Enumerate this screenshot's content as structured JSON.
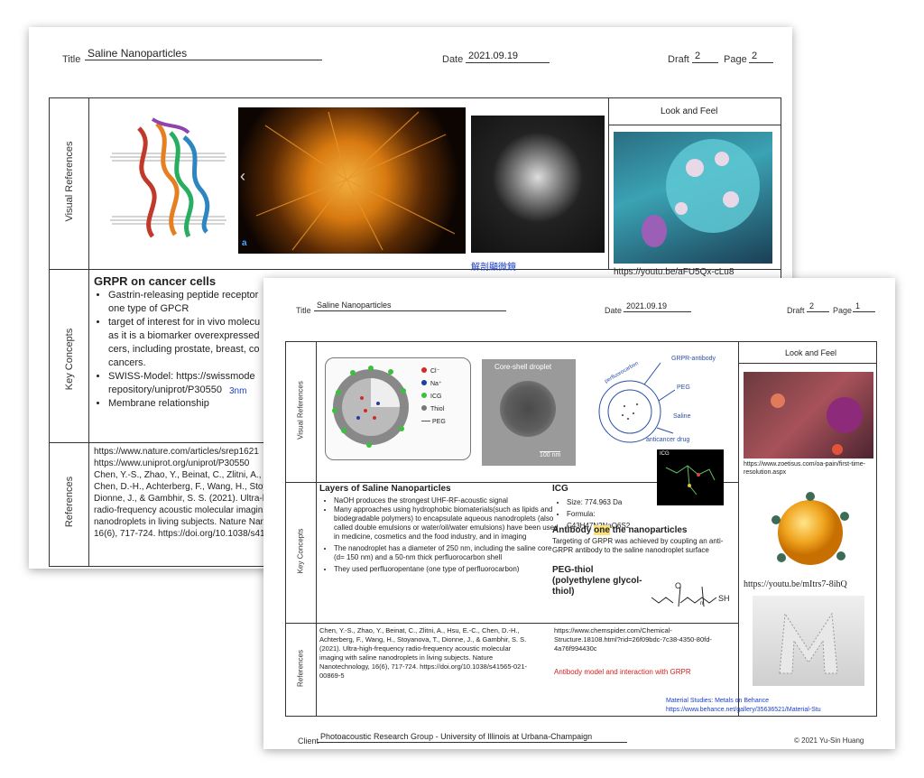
{
  "back_sheet": {
    "title_label": "Title",
    "title": "Saline Nanoparticles",
    "date_label": "Date",
    "date": "2021.09.19",
    "draft_label": "Draft",
    "draft": "2",
    "page_label": "Page",
    "page": "2",
    "row_labels": [
      "Visual References",
      "Key Concepts",
      "References"
    ],
    "look_and_feel_header": "Look and Feel",
    "image_panel_label": "a",
    "sem_caption": "解剖顯微鏡",
    "look_and_feel_url": "https://youtu.be/aFU5Qx-cLu8",
    "key_concepts": {
      "heading": "GRPR on cancer cells",
      "bullets": [
        "Gastrin-releasing peptide receptor",
        "one type of GPCR",
        "target of interest for in vivo molecu",
        "as it is a biomarker overexpressed",
        "cers, including prostate, breast, co",
        "cancers.",
        "SWISS-Model: https://swissmode",
        "repository/uniprot/P30550",
        "Membrane relationship"
      ],
      "annotation": "3nm"
    },
    "references": [
      "https://www.nature.com/articles/srep1621",
      "https://www.uniprot.org/uniprot/P30550",
      "Chen, Y.-S., Zhao, Y., Beinat, C., Zlitni, A., Hs",
      "Chen, D.-H., Achterberg, F., Wang, H., Stoya",
      "Dionne, J., & Gambhir, S. S. (2021). Ultra-hig",
      "radio-frequency acoustic molecular imagin",
      "nanodroplets in living subjects. Nature Nan",
      "16(6), 717-724. https://doi.org/10.1038/s415"
    ]
  },
  "front_sheet": {
    "title_label": "Title",
    "title": "Saline Nanoparticles",
    "date_label": "Date",
    "date": "2021.09.19",
    "draft_label": "Draft",
    "draft": "2",
    "page_label": "Page",
    "page": "1",
    "row_labels": [
      "Visual References",
      "Key Concepts",
      "References"
    ],
    "look_and_feel_header": "Look and Feel",
    "legend": [
      "Cl⁻",
      "Na⁺",
      "ICG",
      "Thiol",
      "PEG"
    ],
    "legend_colors": [
      "#d62828",
      "#1d3fa8",
      "#3cbf3c",
      "#777777",
      "#555555"
    ],
    "tem_title": "Core-shell droplet",
    "tem_scale": "100 nm",
    "sketch_labels": [
      "GRPR-antibody",
      "PEG",
      "Saline",
      "perfluorocarbon",
      "anticancer drug"
    ],
    "icg_thumb_label": "ICG",
    "layers": {
      "heading": "Layers of Saline Nanoparticles",
      "bullets": [
        "NaOH produces the strongest UHF-RF-acoustic signal",
        "Many approaches using hydrophobic biomaterials(such as lipids and biodegradable polymers) to encapsulate aqueous nanodroplets (also called double emulsions or water/oil/water emulsions) have been used in medicine, cosmetics and the food industry, and in imaging",
        "The nanodroplet has a diameter of 250 nm, including the saline core (d= 150 nm) and a 50-nm thick perfluorocarbon shell",
        "They used perfluoropentane (one type of perfluorocarbon)"
      ]
    },
    "icg": {
      "heading": "ICG",
      "bullets": [
        "Size: 774.963 Da",
        "Formula: C43H47N2NaO6S2"
      ]
    },
    "antibody": {
      "heading_pre": "Antibody ",
      "heading_highlight": "one",
      "heading_post": " the nanoparticles",
      "text": "Targeting of GRPR was achieved by coupling an anti-GRPR antibody to the saline nanodroplet surface"
    },
    "peg": {
      "heading": "PEG-thiol (polyethylene glycol-thiol)",
      "formula_o": "O",
      "formula_n": "n",
      "formula_sh": "SH"
    },
    "references_left": "Chen, Y.-S., Zhao, Y., Beinat, C., Zlitni, A., Hsu, E.-C., Chen, D.-H., Achterberg, F., Wang, H., Stoyanova, T., Dionne, J., & Gambhir, S. S. (2021). Ultra-high-frequency radio-frequency acoustic molecular imaging with saline nanodroplets in living subjects. Nature Nanotechnology, 16(6), 717-724. https://doi.org/10.1038/s41565-021-00869-5",
    "references_right": "https://www.chemspider.com/Chemical-Structure.18108.html?rid=26f09bdc-7c38-4350-80fd-4a76f994430c",
    "references_red": "Antibody model and interaction with GRPR",
    "look_and_feel_url1": "https://www.zoetisus.com/oa-pain/first-time-resolution.aspx",
    "look_and_feel_url2": "https://youtu.be/mItrs7-8ihQ",
    "material_caption": "Material Studies: Metals on Behance",
    "material_url": "https://www.behance.net/gallery/35636521/Material-Stu",
    "client_label": "Client",
    "client": "Photoacoustic Research Group - University of Illinois at Urbana-Champaign",
    "copyright": "© 2021 Yu-Sin Huang"
  }
}
